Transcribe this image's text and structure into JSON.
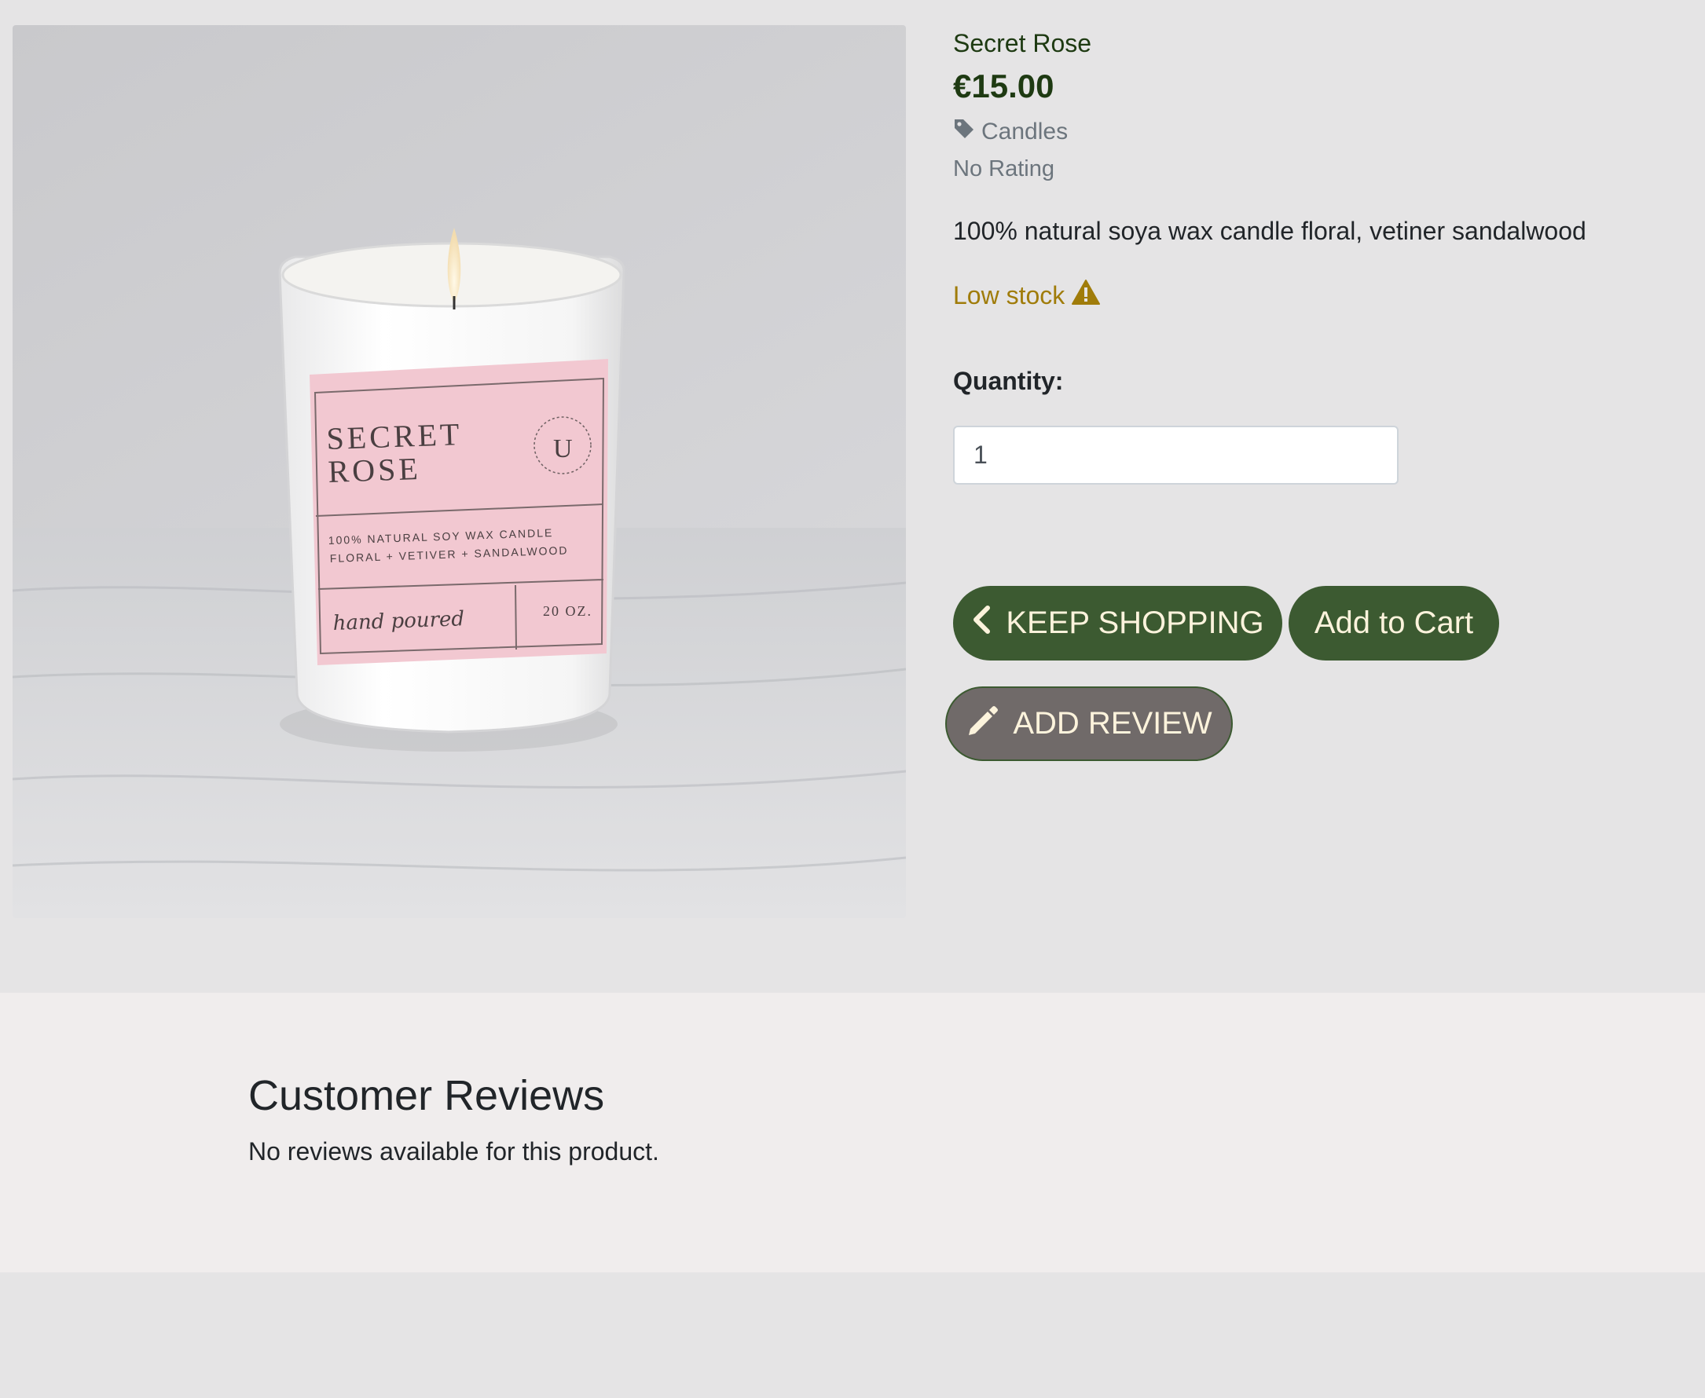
{
  "product": {
    "name": "Secret Rose",
    "price": "€15.00",
    "category": "Candles",
    "rating": "No Rating",
    "description": "100% natural soya wax candle floral, vetiner sandalwood",
    "stock_status": "Low stock",
    "image": {
      "label_line1": "SECRET",
      "label_line2": "ROSE",
      "label_text1": "100% NATURAL SOY WAX CANDLE",
      "label_text2": "FLORAL + VETIVER + SANDALWOOD",
      "label_script": "hand poured",
      "label_size": "20 OZ.",
      "logo_letter": "U"
    }
  },
  "quantity": {
    "label": "Quantity:",
    "value": "1"
  },
  "buttons": {
    "keep_shopping": "KEEP SHOPPING",
    "add_to_cart": "Add to Cart",
    "add_review": "ADD REVIEW"
  },
  "reviews": {
    "title": "Customer Reviews",
    "empty_text": "No reviews available for this product."
  },
  "colors": {
    "brand_green": "#3c5a31",
    "review_button": "#706a69",
    "low_stock": "#a07c0a",
    "page_bg": "#e5e4e5"
  },
  "icons": {
    "category": "tag-icon",
    "stock": "warning-triangle-icon",
    "keep_shopping": "chevron-left-icon",
    "add_review": "pencil-icon"
  }
}
